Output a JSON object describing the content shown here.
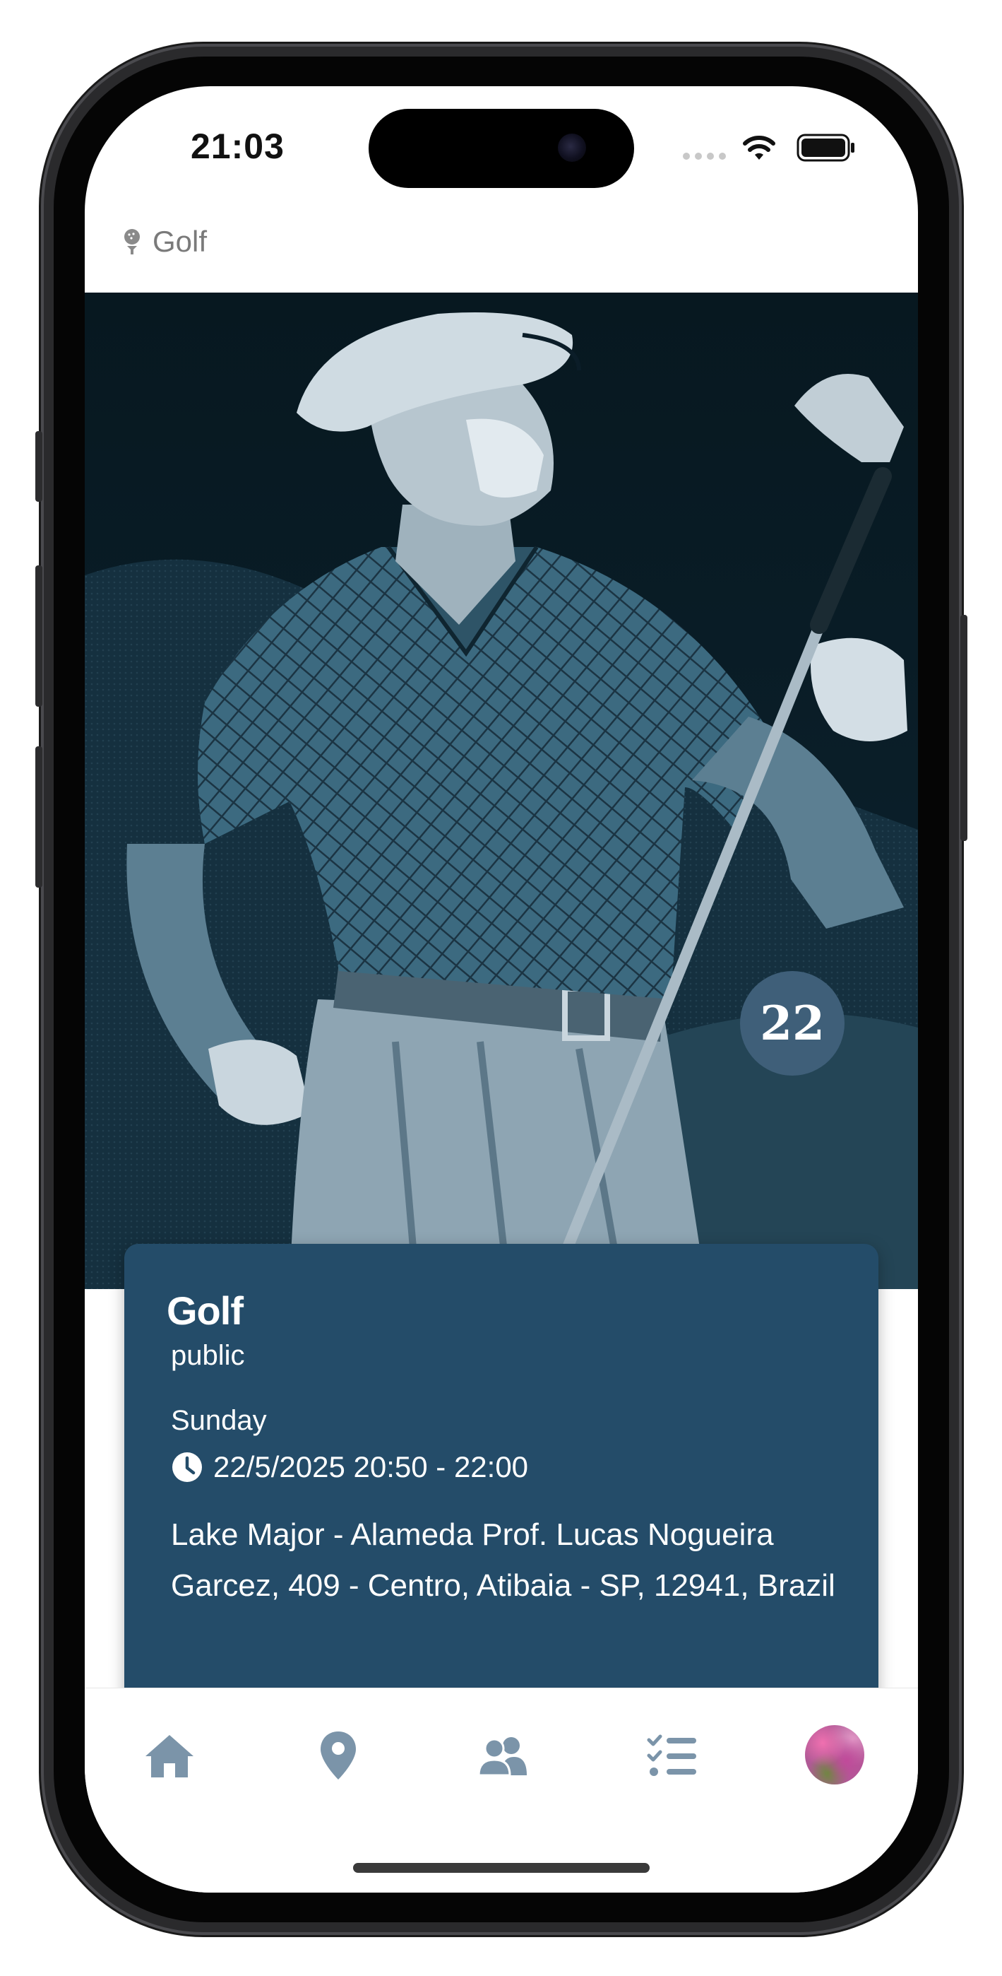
{
  "status_bar": {
    "time": "21:03"
  },
  "breadcrumb": {
    "label": "Golf",
    "icon": "golf-ball-tee-icon"
  },
  "hero": {
    "date_badge": "22",
    "image": "golfer-illustration"
  },
  "event": {
    "title": "Golf",
    "visibility": "public",
    "day": "Sunday",
    "datetime": "22/5/2025 20:50 - 22:00",
    "address": "Lake Major - Alameda Prof. Lucas Nogueira Garcez, 409 - Centro, Atibaia - SP, 12941, Brazil"
  },
  "tabbar": {
    "items": [
      {
        "name": "home",
        "icon": "home-icon"
      },
      {
        "name": "location",
        "icon": "map-pin-icon"
      },
      {
        "name": "people",
        "icon": "users-icon"
      },
      {
        "name": "tasks",
        "icon": "checklist-icon"
      },
      {
        "name": "profile",
        "icon": "avatar"
      }
    ]
  },
  "colors": {
    "card_bg": "#244c69",
    "badge_bg": "#3f5f79",
    "tab_icon": "#7b94a9",
    "hero_bg": "#0b1d28"
  }
}
